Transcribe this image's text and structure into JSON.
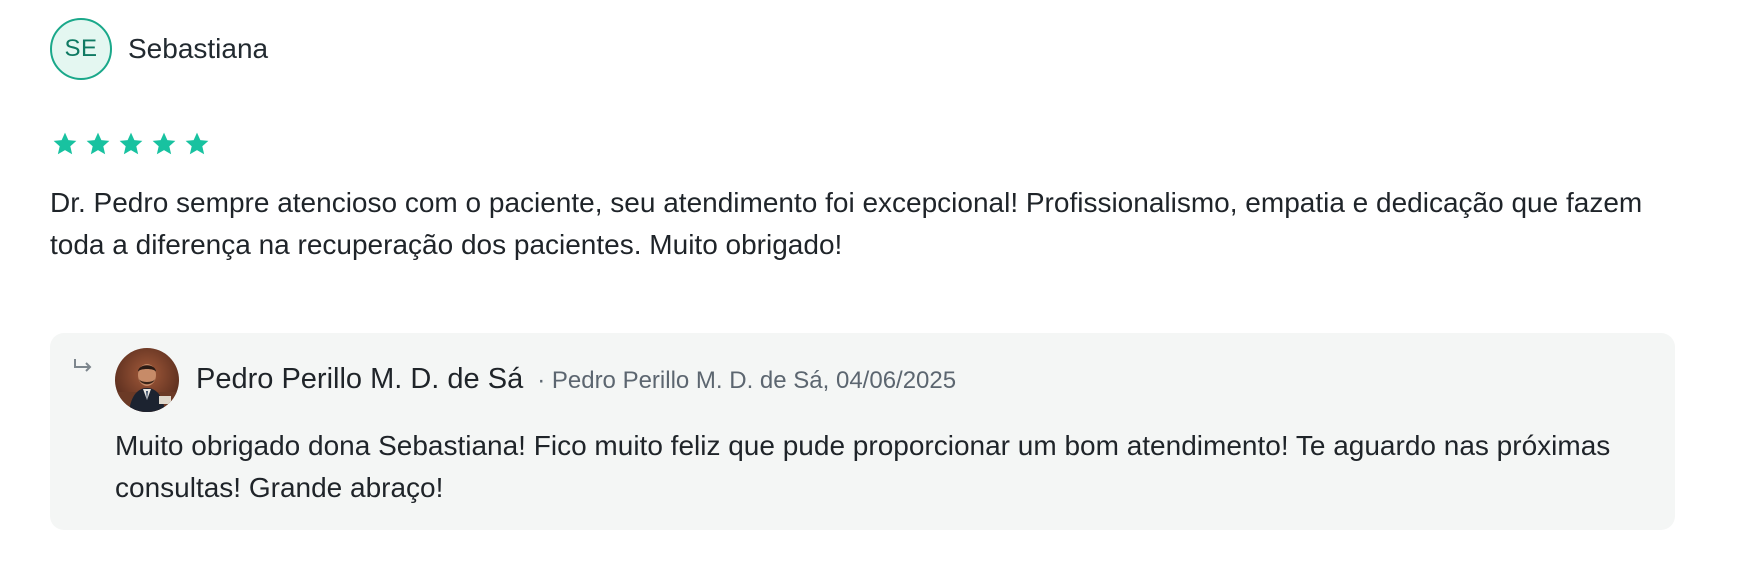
{
  "review": {
    "reviewer_initials": "SE",
    "reviewer_name": "Sebastiana",
    "rating": 5,
    "rating_max": 5,
    "text": "Dr. Pedro sempre atencioso com o paciente, seu atendimento foi excepcional! Profissionalismo, empatia e dedicação que fazem toda a diferença na recuperação dos pacientes. Muito obrigado!"
  },
  "reply": {
    "author": "Pedro Perillo M. D. de Sá",
    "meta": "· Pedro Perillo M. D. de Sá, 04/06/2025",
    "text": "Muito obrigado dona Sebastiana! Fico muito feliz que pude proporcionar um bom atendimento! Te aguardo nas próximas consultas! Grande abraço!",
    "avatar_icon": "doctor-photo-avatar",
    "reply_icon": "reply-arrow-icon"
  },
  "colors": {
    "star": "#18c2a0",
    "avatar_border": "#1aa88a",
    "avatar_bg": "#e4f7f1",
    "reply_bg": "#f4f6f5"
  }
}
